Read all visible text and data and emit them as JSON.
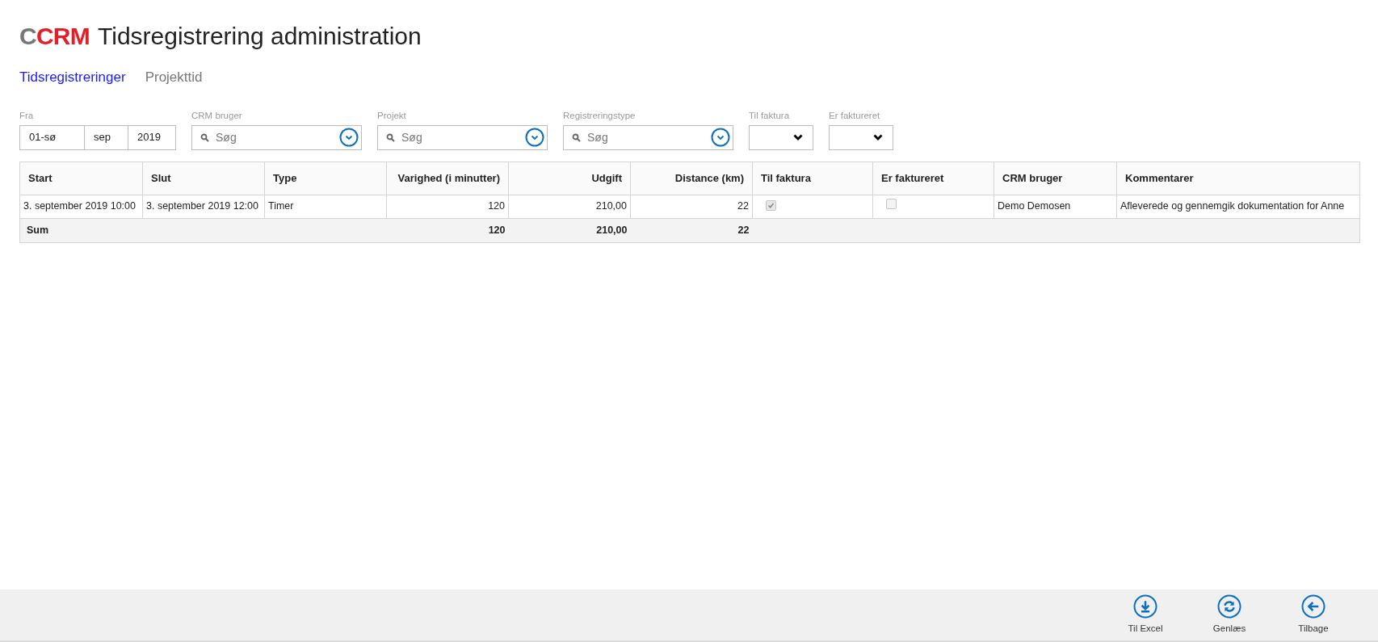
{
  "header": {
    "logo": [
      {
        "text": "C",
        "kind": "grey"
      },
      {
        "text": "CRM",
        "kind": "red"
      }
    ],
    "title": "Tidsregistrering administration"
  },
  "tabs": [
    {
      "label": "Tidsregistreringer",
      "selected": true
    },
    {
      "label": "Projekttid",
      "selected": false
    }
  ],
  "filters": {
    "fra": {
      "label": "Fra",
      "parts": [
        "01-sø",
        "sep",
        "2019"
      ]
    },
    "lookups": [
      {
        "label": "CRM bruger",
        "placeholder": "Søg"
      },
      {
        "label": "Projekt",
        "placeholder": "Søg"
      },
      {
        "label": "Registreringstype",
        "placeholder": "Søg"
      }
    ],
    "selects": [
      {
        "label": "Til faktura"
      },
      {
        "label": "Er faktureret"
      }
    ]
  },
  "table": {
    "columns": [
      {
        "label": "Start"
      },
      {
        "label": "Slut"
      },
      {
        "label": "Type"
      },
      {
        "label": "Varighed (i minutter)"
      },
      {
        "label": "Udgift"
      },
      {
        "label": "Distance (km)"
      },
      {
        "label": "Til faktura"
      },
      {
        "label": "Er faktureret"
      },
      {
        "label": "CRM bruger"
      },
      {
        "label": "Kommentarer"
      }
    ],
    "rows": [
      {
        "cells": [
          {
            "kind": "text",
            "text": "3. september 2019 10:00"
          },
          {
            "kind": "text",
            "text": "3. september 2019 12:00"
          },
          {
            "kind": "text",
            "text": "Timer"
          },
          {
            "kind": "text",
            "text": "120"
          },
          {
            "kind": "text",
            "text": "210,00"
          },
          {
            "kind": "text",
            "text": "22"
          },
          {
            "kind": "check",
            "checked": true
          },
          {
            "kind": "check",
            "checked": false
          },
          {
            "kind": "text",
            "text": "Demo Demosen"
          },
          {
            "kind": "text",
            "text": "Afleverede og gennemgik dokumentation for Anne"
          }
        ]
      }
    ],
    "sum": {
      "label": "Sum",
      "cells": [
        "",
        "",
        "",
        "120",
        "210,00",
        "22",
        "",
        "",
        "",
        ""
      ]
    }
  },
  "footer_buttons": [
    {
      "label": "Til Excel"
    },
    {
      "label": "Genlæs"
    },
    {
      "label": "Tilbage"
    }
  ]
}
